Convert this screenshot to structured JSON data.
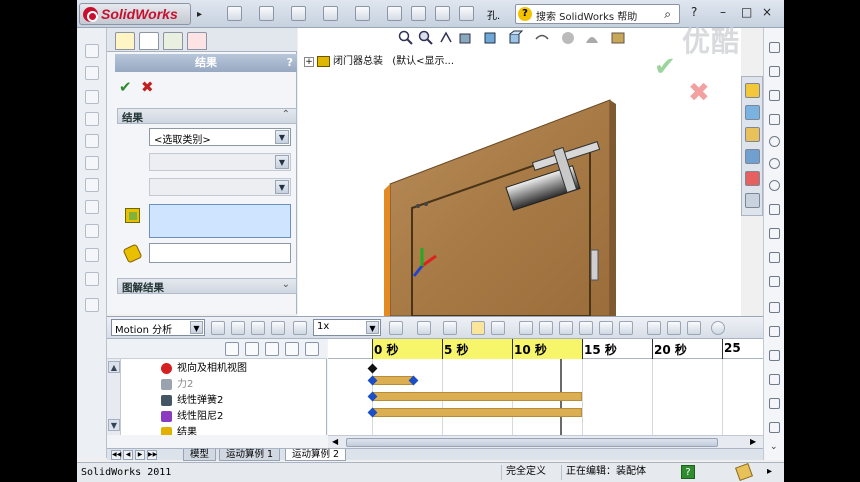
{
  "app": {
    "name": "SolidWorks",
    "search_placeholder": "搜索 SolidWorks 帮助",
    "help_label": "?",
    "minimize": "–",
    "restore": "□",
    "close": "×",
    "title_fragment": "孔."
  },
  "property_manager": {
    "title": "结果",
    "help": "?",
    "ok": "✔",
    "cancel": "✖",
    "section_results": "结果",
    "type_select": {
      "value": "<选取类别>"
    },
    "section_plot": "图解结果",
    "chev_up": "⌃",
    "chev_down": "⌄"
  },
  "feature_tree": {
    "plus": "+",
    "assembly": "闭门器总装",
    "config": "(默认<显示..."
  },
  "motion": {
    "study_type": "Motion 分析",
    "playback_speed": "1x",
    "timeline": {
      "labels": [
        "0 秒",
        "5 秒",
        "10 秒",
        "15 秒",
        "20 秒",
        "25"
      ]
    },
    "tree_items": [
      {
        "label": "视向及相机视图",
        "icon_color": "#d32020"
      },
      {
        "label": "力2",
        "icon_color": "#9aa3ae"
      },
      {
        "label": "线性弹簧2",
        "icon_color": "#445566"
      },
      {
        "label": "线性阻尼2",
        "icon_color": "#8a3cc0"
      },
      {
        "label": "结果",
        "icon_color": "#e2b100"
      }
    ]
  },
  "bottom_tabs": [
    "模型",
    "运动算例 1",
    "运动算例 2"
  ],
  "status": {
    "app_version": "SolidWorks 2011",
    "defined": "完全定义",
    "editing": "正在编辑：装配体",
    "help": "?"
  },
  "watermark": "优酷"
}
